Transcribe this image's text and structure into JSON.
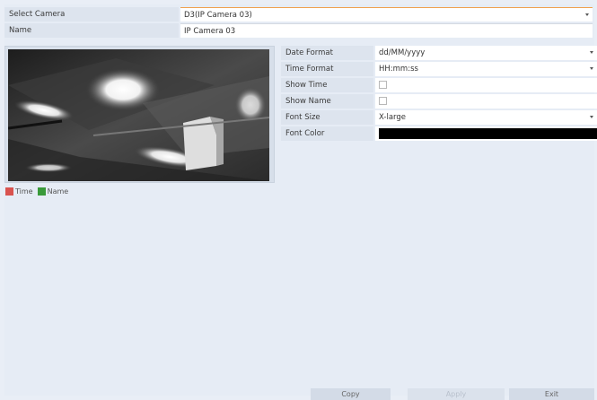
{
  "header": {
    "select_camera_label": "Select Camera",
    "select_camera_value": "D3(IP Camera 03)",
    "name_label": "Name",
    "name_value": "IP Camera 03"
  },
  "legend": [
    {
      "label": "Time",
      "color": "#d9534f"
    },
    {
      "label": "Name",
      "color": "#3a9a3a"
    }
  ],
  "settings": {
    "date_format_label": "Date Format",
    "date_format_value": "dd/MM/yyyy",
    "time_format_label": "Time Format",
    "time_format_value": "HH:mm:ss",
    "show_time_label": "Show Time",
    "show_time_checked": false,
    "show_name_label": "Show Name",
    "show_name_checked": false,
    "font_size_label": "Font Size",
    "font_size_value": "X-large",
    "font_color_label": "Font Color",
    "font_color_value": "#000000"
  },
  "buttons": {
    "copy": "Copy",
    "apply": "Apply",
    "exit": "Exit"
  },
  "colors": {
    "background": "#e9eef6",
    "label_bg": "#dde4ee",
    "accent": "#f0a04b"
  }
}
